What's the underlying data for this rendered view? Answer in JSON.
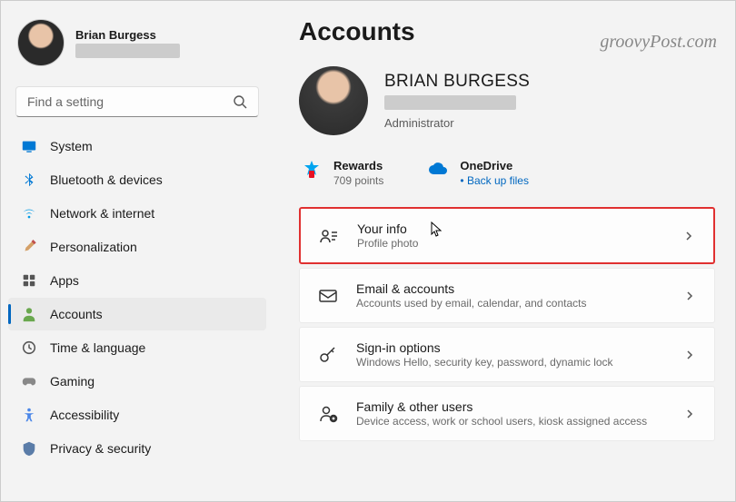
{
  "watermark": "groovyPost.com",
  "profile": {
    "name": "Brian Burgess"
  },
  "search": {
    "placeholder": "Find a setting"
  },
  "nav": [
    {
      "label": "System"
    },
    {
      "label": "Bluetooth & devices"
    },
    {
      "label": "Network & internet"
    },
    {
      "label": "Personalization"
    },
    {
      "label": "Apps"
    },
    {
      "label": "Accounts"
    },
    {
      "label": "Time & language"
    },
    {
      "label": "Gaming"
    },
    {
      "label": "Accessibility"
    },
    {
      "label": "Privacy & security"
    }
  ],
  "page": {
    "title": "Accounts",
    "user_name": "BRIAN BURGESS",
    "role": "Administrator"
  },
  "cards": {
    "rewards": {
      "title": "Rewards",
      "sub": "709 points"
    },
    "onedrive": {
      "title": "OneDrive",
      "link": "Back up files"
    }
  },
  "settings": [
    {
      "title": "Your info",
      "sub": "Profile photo"
    },
    {
      "title": "Email & accounts",
      "sub": "Accounts used by email, calendar, and contacts"
    },
    {
      "title": "Sign-in options",
      "sub": "Windows Hello, security key, password, dynamic lock"
    },
    {
      "title": "Family & other users",
      "sub": "Device access, work or school users, kiosk assigned access"
    }
  ]
}
